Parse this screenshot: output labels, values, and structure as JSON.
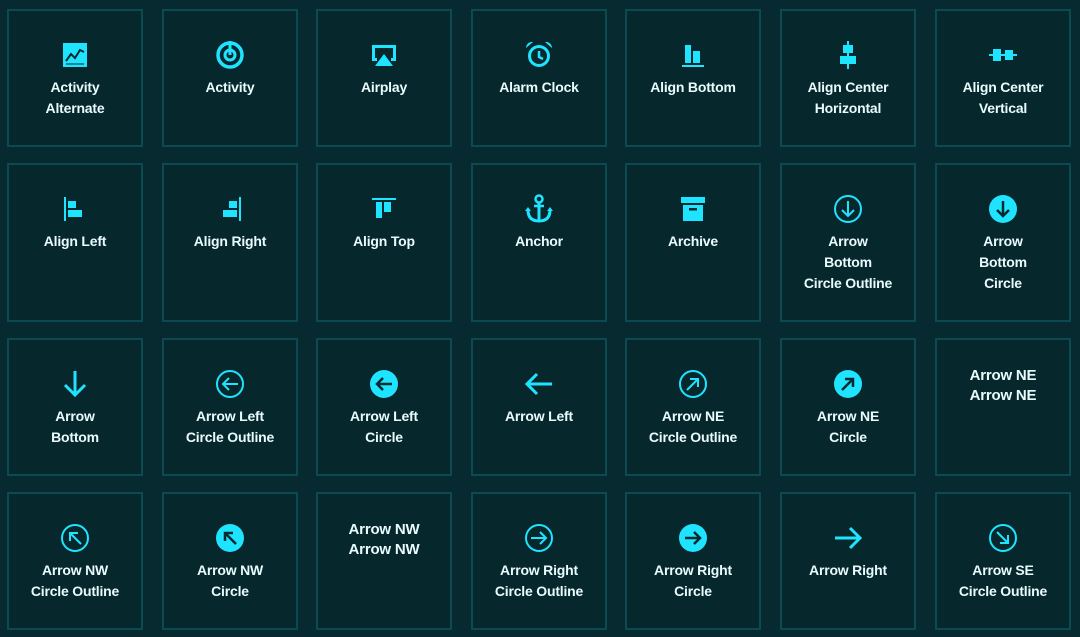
{
  "icon_color": "#1ee4ff",
  "tile_border_color": "#0b4a52",
  "background": "#062a2f",
  "tiles": [
    {
      "label": "Activity\nAlternate",
      "icon": "activity-alternate-icon"
    },
    {
      "label": "Activity",
      "icon": "activity-icon"
    },
    {
      "label": "Airplay",
      "icon": "airplay-icon"
    },
    {
      "label": "Alarm Clock",
      "icon": "alarm-clock-icon"
    },
    {
      "label": "Align Bottom",
      "icon": "align-bottom-icon"
    },
    {
      "label": "Align Center\nHorizontal",
      "icon": "align-center-horizontal-icon"
    },
    {
      "label": "Align Center\nVertical",
      "icon": "align-center-vertical-icon"
    },
    {
      "label": "Align Left",
      "icon": "align-left-icon"
    },
    {
      "label": "Align Right",
      "icon": "align-right-icon"
    },
    {
      "label": "Align Top",
      "icon": "align-top-icon"
    },
    {
      "label": "Anchor",
      "icon": "anchor-icon"
    },
    {
      "label": "Archive",
      "icon": "archive-icon"
    },
    {
      "label": "Arrow\nBottom\nCircle Outline",
      "icon": "arrow-bottom-circle-outline-icon"
    },
    {
      "label": "Arrow\nBottom\nCircle",
      "icon": "arrow-bottom-circle-icon"
    },
    {
      "label": "Arrow\nBottom",
      "icon": "arrow-bottom-icon"
    },
    {
      "label": "Arrow Left\nCircle Outline",
      "icon": "arrow-left-circle-outline-icon"
    },
    {
      "label": "Arrow Left\nCircle",
      "icon": "arrow-left-circle-icon"
    },
    {
      "label": "Arrow Left",
      "icon": "arrow-left-icon"
    },
    {
      "label": "Arrow NE\nCircle Outline",
      "icon": "arrow-ne-circle-outline-icon"
    },
    {
      "label": "Arrow NE\nCircle",
      "icon": "arrow-ne-circle-icon"
    },
    {
      "label": "Arrow NE\nArrow NE",
      "icon": null
    },
    {
      "label": "Arrow NW\nCircle Outline",
      "icon": "arrow-nw-circle-outline-icon"
    },
    {
      "label": "Arrow NW\nCircle",
      "icon": "arrow-nw-circle-icon"
    },
    {
      "label": "Arrow NW\nArrow NW",
      "icon": null
    },
    {
      "label": "Arrow Right\nCircle Outline",
      "icon": "arrow-right-circle-outline-icon"
    },
    {
      "label": "Arrow Right\nCircle",
      "icon": "arrow-right-circle-icon"
    },
    {
      "label": "Arrow Right",
      "icon": "arrow-right-icon"
    },
    {
      "label": "Arrow SE\nCircle Outline",
      "icon": "arrow-se-circle-outline-icon"
    }
  ]
}
